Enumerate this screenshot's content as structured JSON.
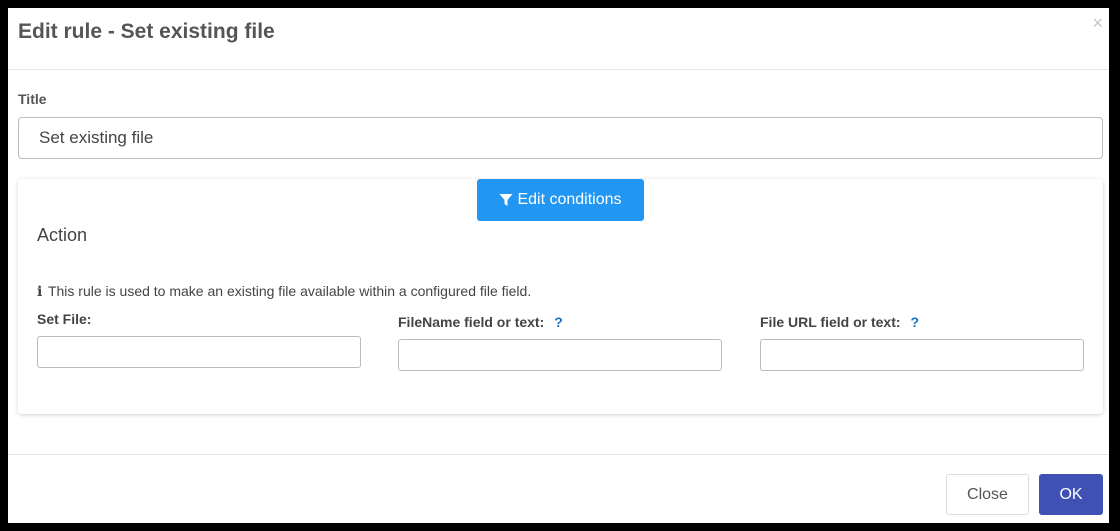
{
  "dialog": {
    "title": "Edit rule - Set existing file",
    "close_glyph": "×"
  },
  "form": {
    "title_label": "Title",
    "title_value": "Set existing file"
  },
  "panel": {
    "edit_conditions_label": "Edit conditions",
    "action_heading": "Action",
    "info_text": "This rule is used to make an existing file available within a configured file field.",
    "fields": [
      {
        "label": "Set File:",
        "value": ""
      },
      {
        "label": "FileName field or text:",
        "value": "",
        "help": "?"
      },
      {
        "label": "File URL field or text:",
        "value": "",
        "help": "?"
      }
    ]
  },
  "footer": {
    "close_label": "Close",
    "ok_label": "OK"
  },
  "colors": {
    "primary_blue": "#2196f3",
    "ok_indigo": "#3f51b5",
    "help_blue": "#1a73c8"
  }
}
